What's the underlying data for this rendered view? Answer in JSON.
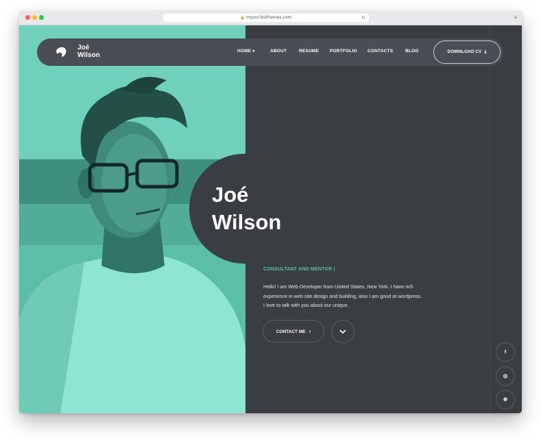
{
  "browser": {
    "url": "myour.bslthemes.com"
  },
  "nav": {
    "brand_first": "Joé",
    "brand_last": "Wilson",
    "items": [
      {
        "label": "HOME"
      },
      {
        "label": "ABOUT"
      },
      {
        "label": "RESUME"
      },
      {
        "label": "PORTFOLIO"
      },
      {
        "label": "CONTACTS"
      },
      {
        "label": "BLOG"
      }
    ],
    "download_label": "DOWNLOAD CV"
  },
  "hero": {
    "name_first": "Joé",
    "name_last": "Wilson",
    "subtitle": "CONSULTANT AND MENTOR |",
    "bio": "Hello! I am Web Developer from United States, New York. I have rich experience in web site design and building, also I am good at wordpress. I love to talk with you about our unique.",
    "contact_label": "CONTACT ME"
  },
  "social": [
    {
      "icon": "facebook-icon",
      "glyph": "f"
    },
    {
      "icon": "instagram-icon",
      "glyph": "◎"
    },
    {
      "icon": "dribbble-icon",
      "glyph": "⊕"
    }
  ],
  "colors": {
    "accent": "#5bbfa7",
    "dark": "#3a3d42",
    "navbar": "#4a4d53"
  }
}
